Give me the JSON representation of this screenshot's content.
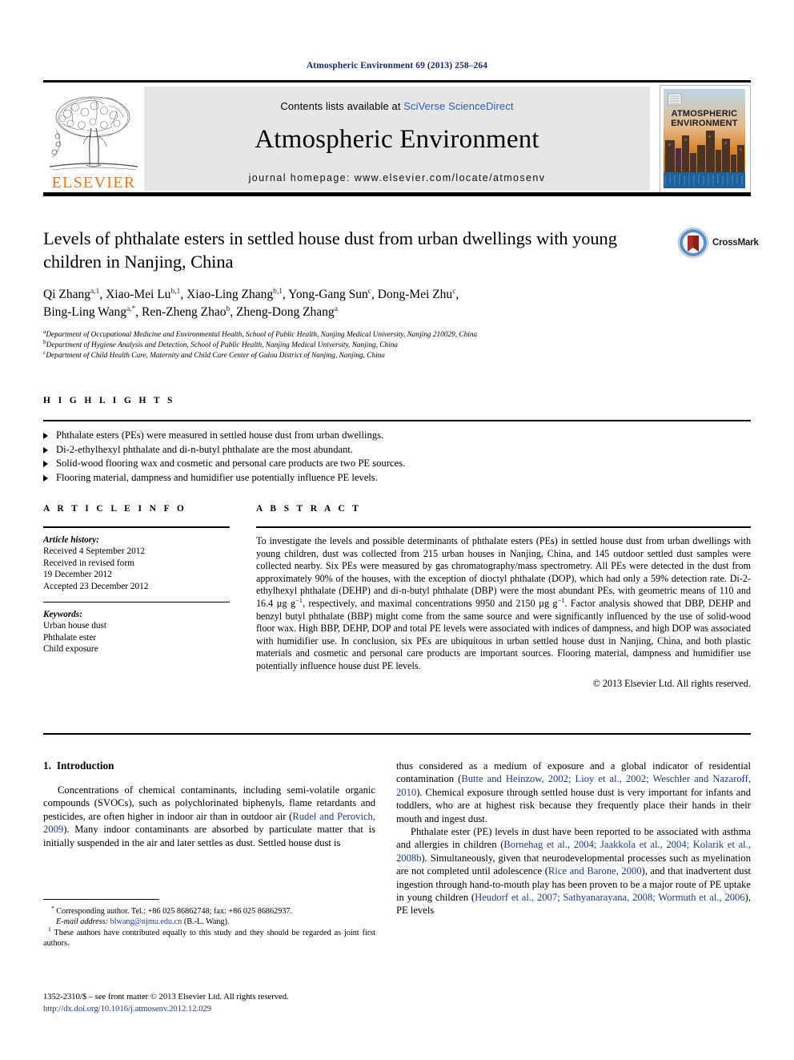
{
  "running_head": "Atmospheric Environment 69 (2013) 258–264",
  "masthead": {
    "publisher_name": "ELSEVIER",
    "contents_prefix": "Contents lists available at ",
    "contents_link": "SciVerse ScienceDirect",
    "journal_title": "Atmospheric Environment",
    "homepage": "journal homepage: www.elsevier.com/locate/atmosenv",
    "cover_title_line1": "ATMOSPHERIC",
    "cover_title_line2": "ENVIRONMENT"
  },
  "article": {
    "title": "Levels of phthalate esters in settled house dust from urban dwellings with young children in Nanjing, China",
    "crossmark_label": "CrossMark",
    "authors_line1": "Qi Zhang a,1, Xiao-Mei Lu b,1, Xiao-Ling Zhang b,1, Yong-Gang Sun c, Dong-Mei Zhu c,",
    "authors_line2": "Bing-Ling Wang a,*, Ren-Zheng Zhao b, Zheng-Dong Zhang a",
    "authors": [
      {
        "name": "Qi Zhang",
        "marks": "a,1",
        "sep": ", "
      },
      {
        "name": "Xiao-Mei Lu",
        "marks": "b,1",
        "sep": ", "
      },
      {
        "name": "Xiao-Ling Zhang",
        "marks": "b,1",
        "sep": ", "
      },
      {
        "name": "Yong-Gang Sun",
        "marks": "c",
        "sep": ", "
      },
      {
        "name": "Dong-Mei Zhu",
        "marks": "c",
        "sep": ", "
      },
      {
        "name": "Bing-Ling Wang",
        "marks": "a,*",
        "sep": ", "
      },
      {
        "name": "Ren-Zheng Zhao",
        "marks": "b",
        "sep": ", "
      },
      {
        "name": "Zheng-Dong Zhang",
        "marks": "a",
        "sep": ""
      }
    ],
    "affiliations": [
      {
        "mark": "a",
        "text": "Department of Occupational Medicine and Environmental Health, School of Public Health, Nanjing Medical University, Nanjing 210029, China"
      },
      {
        "mark": "b",
        "text": "Department of Hygiene Analysis and Detection, School of Public Health, Nanjing Medical University, Nanjing, China"
      },
      {
        "mark": "c",
        "text": "Department of Child Health Care, Maternity and Child Care Center of Gulou District of Nanjing, Nanjing, China"
      }
    ]
  },
  "highlights": {
    "heading": "H I G H L I G H T S",
    "items": [
      "Phthalate esters (PEs) were measured in settled house dust from urban dwellings.",
      "Di-2-ethylhexyl phthalate and di-n-butyl phthalate are the most abundant.",
      "Solid-wood flooring wax and cosmetic and personal care products are two PE sources.",
      "Flooring material, dampness and humidifier use potentially influence PE levels."
    ]
  },
  "article_info": {
    "heading": "A R T I C L E  I N F O",
    "history_label": "Article history:",
    "history": [
      "Received 4 September 2012",
      "Received in revised form",
      "19 December 2012",
      "Accepted 23 December 2012"
    ],
    "keywords_label": "Keywords:",
    "keywords": [
      "Urban house dust",
      "Phthalate ester",
      "Child exposure"
    ]
  },
  "abstract": {
    "heading": "A B S T R A C T",
    "paragraph_part1": "To investigate the levels and possible determinants of phthalate esters (PEs) in settled house dust from urban dwellings with young children, dust was collected from 215 urban houses in Nanjing, China, and 145 outdoor settled dust samples were collected nearby. Six PEs were measured by gas chromatography/mass spectrometry. All PEs were detected in the dust from approximately 90% of the houses, with the exception of dioctyl phthalate (DOP), which had only a 59% detection rate. Di-2-ethylhexyl phthalate (DEHP) and di-n-butyl phthalate (DBP) were the most abundant PEs, with geometric means of 110 and 16.4 µg g",
    "sup1": "−1",
    "paragraph_part2": ", respectively, and maximal concentrations 9950 and 2150 µg g",
    "sup2": "−1",
    "paragraph_part3": ". Factor analysis showed that DBP, DEHP and benzyl butyl phthalate (BBP) might come from the same source and were significantly influenced by the use of solid-wood floor wax. High BBP, DEHP, DOP and total PE levels were associated with indices of dampness, and high DOP was associated with humidifier use. In conclusion, six PEs are ubiquitous in urban settled house dust in Nanjing, China, and both plastic materials and cosmetic and personal care products are important sources. Flooring material, dampness and humidifier use potentially influence house dust PE levels.",
    "copyright": "© 2013 Elsevier Ltd. All rights reserved."
  },
  "body": {
    "section_number": "1.",
    "section_title": "Introduction",
    "left_paragraph_1_a": "Concentrations of chemical contaminants, including semi-volatile organic compounds (SVOCs), such as polychlorinated biphenyls, flame retardants and pesticides, are often higher in indoor air than in outdoor air (",
    "left_ref_1": "Rudel and Perovich, 2009",
    "left_paragraph_1_b": "). Many indoor contaminants are absorbed by particulate matter that is initially suspended in the air and later settles as dust. Settled house dust is",
    "right_paragraph_1_a": "thus considered as a medium of exposure and a global indicator of residential contamination (",
    "right_ref_1": "Butte and Heinzow, 2002; Lioy et al., 2002; Weschler and Nazaroff, 2010",
    "right_paragraph_1_b": "). Chemical exposure through settled house dust is very important for infants and toddlers, who are at highest risk because they frequently place their hands in their mouth and ingest dust.",
    "right_paragraph_2_a": "Phthalate ester (PE) levels in dust have been reported to be associated with asthma and allergies in children (",
    "right_ref_2": "Bornehag et al., 2004; Jaakkola et al., 2004; Kolarik et al., 2008b",
    "right_paragraph_2_b": "). Simultaneously, given that neurodevelopmental processes such as myelination are not completed until adolescence (",
    "right_ref_3": "Rice and Barone, 2000",
    "right_paragraph_2_c": "), and that inadvertent dust ingestion through hand-to-mouth play has been proven to be a major route of PE uptake in young children (",
    "right_ref_4": "Heudorf et al., 2007; Sathyanarayana, 2008; Wormuth et al., 2006",
    "right_paragraph_2_d": "), PE levels"
  },
  "footnotes": {
    "corresponding_mark": "*",
    "corresponding_text": " Corresponding author. Tel.: +86 025 86862748; fax: +86 025 86862937.",
    "email_label": "E-mail address:",
    "email": "blwang@njmu.edu.cn",
    "email_suffix": " (B.-L. Wang).",
    "equal_mark": "1",
    "equal_text": " These authors have contributed equally to this study and they should be regarded as joint first authors."
  },
  "imprint": {
    "line1": "1352-2310/$ – see front matter © 2013 Elsevier Ltd. All rights reserved.",
    "doi": "http://dx.doi.org/10.1016/j.atmosenv.2012.12.029"
  },
  "colors": {
    "elsevier_orange": "#E87722",
    "link_blue": "#1a3b8f",
    "sciencedirect_blue": "#2c5fa8",
    "runhead_navy": "#1a2a6b",
    "band_grey": "#e6e6e6"
  }
}
